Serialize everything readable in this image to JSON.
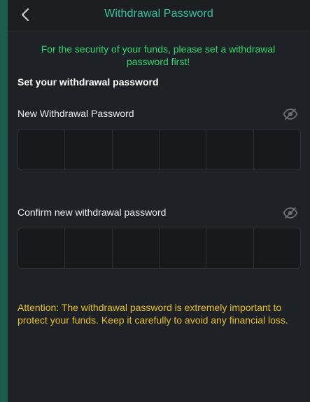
{
  "header": {
    "title": "Withdrawal Password",
    "back_icon": "chevron-left-icon"
  },
  "notice": "For the security of your funds, please set a withdrawal password first!",
  "section_title": "Set your withdrawal password",
  "new_password": {
    "label": "New Withdrawal Password",
    "visibility_icon": "eye-off-icon",
    "digits": 6,
    "value": ""
  },
  "confirm_password": {
    "label": "Confirm new withdrawal password",
    "visibility_icon": "eye-off-icon",
    "digits": 6,
    "value": ""
  },
  "attention": "Attention: The withdrawal password is extremely important to protect your funds. Keep it carefully to avoid any financial loss.",
  "colors": {
    "background": "#1e2126",
    "accent": "#36c3a0",
    "notice_green": "#2fd96f",
    "warning_yellow": "#e7c025",
    "side_strip": "#1b5e4d"
  }
}
